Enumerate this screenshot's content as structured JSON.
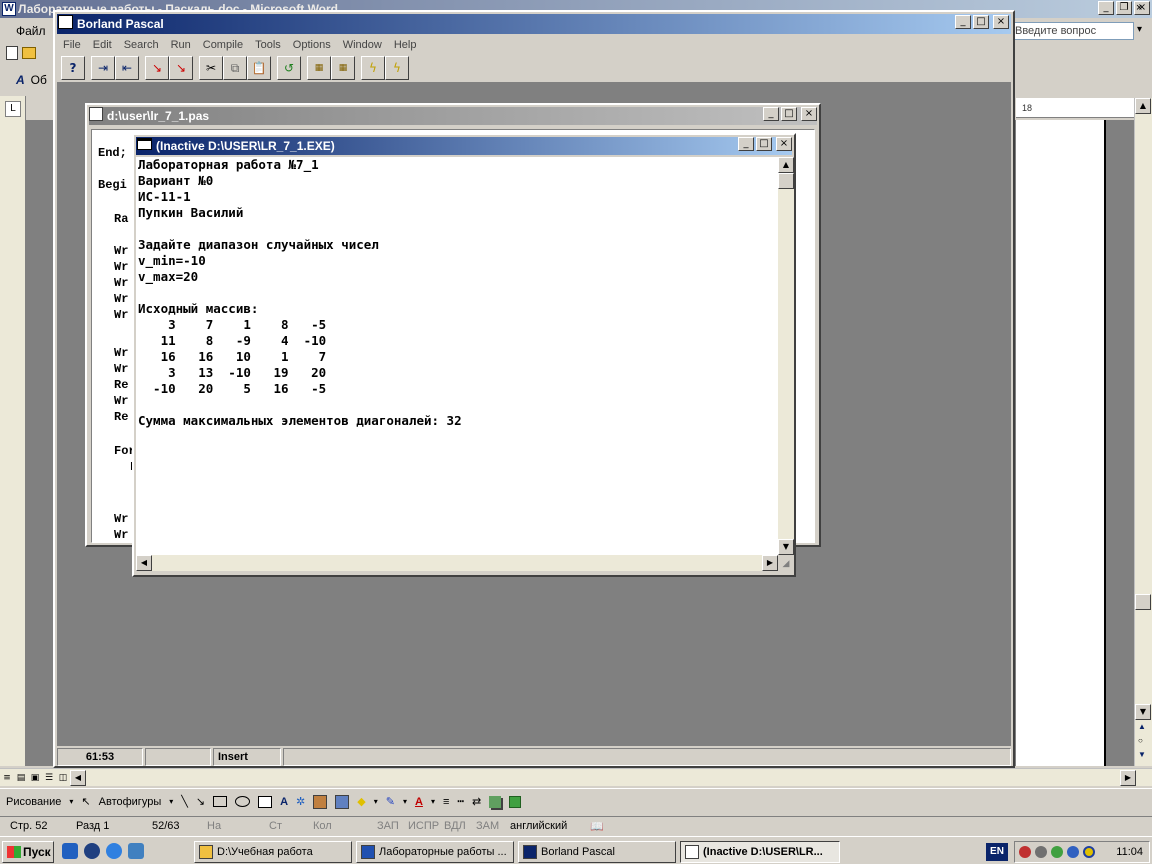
{
  "word": {
    "title": "Лабораторные работы - Паскаль.doc - Microsoft Word",
    "menu_file": "Файл",
    "ask_placeholder": "Введите вопрос",
    "ruler_value": "18",
    "style_label": "Об",
    "status": {
      "page": "Стр. 52",
      "section": "Разд 1",
      "pages": "52/63",
      "at": "На",
      "line": "Ст",
      "col": "Кол",
      "rec": "ЗАП",
      "trk": "ИСПР",
      "ext": "ВДЛ",
      "ovr": "ЗАМ",
      "lang": "английский"
    },
    "draw": {
      "drawing_label": "Рисование",
      "autoshapes_label": "Автофигуры"
    }
  },
  "bp": {
    "title": "Borland Pascal",
    "menu": [
      "File",
      "Edit",
      "Search",
      "Run",
      "Compile",
      "Tools",
      "Options",
      "Window",
      "Help"
    ],
    "status": {
      "position": "61:53",
      "modified": "",
      "mode": "Insert"
    }
  },
  "editor": {
    "title": "d:\\user\\lr_7_1.pas",
    "lines": {
      "l1": "End;",
      "l2": "Begi",
      "l3": "Ra",
      "l4": "Wr",
      "l5": "Wr",
      "l6": "Wr",
      "l7": "Wr",
      "l8": "Wr",
      "l9": "Wr",
      "l10": "Wr",
      "l11": "Re",
      "l12": "Wr",
      "l13": "Re",
      "l14": "For",
      "l15": "F",
      "l16": "Wr",
      "l17": "Wr"
    }
  },
  "console": {
    "title": "(Inactive D:\\USER\\LR_7_1.EXE)",
    "output": "Лабораторная работа №7_1\nВариант №0\nИС-11-1\nПупкин Василий\n\nЗадайте диапазон случайных чисел\nv_min=-10\nv_max=20\n\nИсходный массив:\n    3    7    1    8   -5\n   11    8   -9    4  -10\n   16   16   10    1    7\n    3   13  -10   19   20\n  -10   20    5   16   -5\n\nСумма максимальных элементов диагоналей: 32"
  },
  "taskbar": {
    "start": "Пуск",
    "tasks": [
      "D:\\Учебная работа",
      "Лабораторные работы ...",
      "Borland Pascal",
      "(Inactive D:\\USER\\LR..."
    ],
    "lang": "EN",
    "clock": "11:04"
  },
  "colors": {
    "title_active": "#0a246a",
    "title_inactive": "#808080",
    "desk": "#808080",
    "face": "#d4d0c8"
  }
}
